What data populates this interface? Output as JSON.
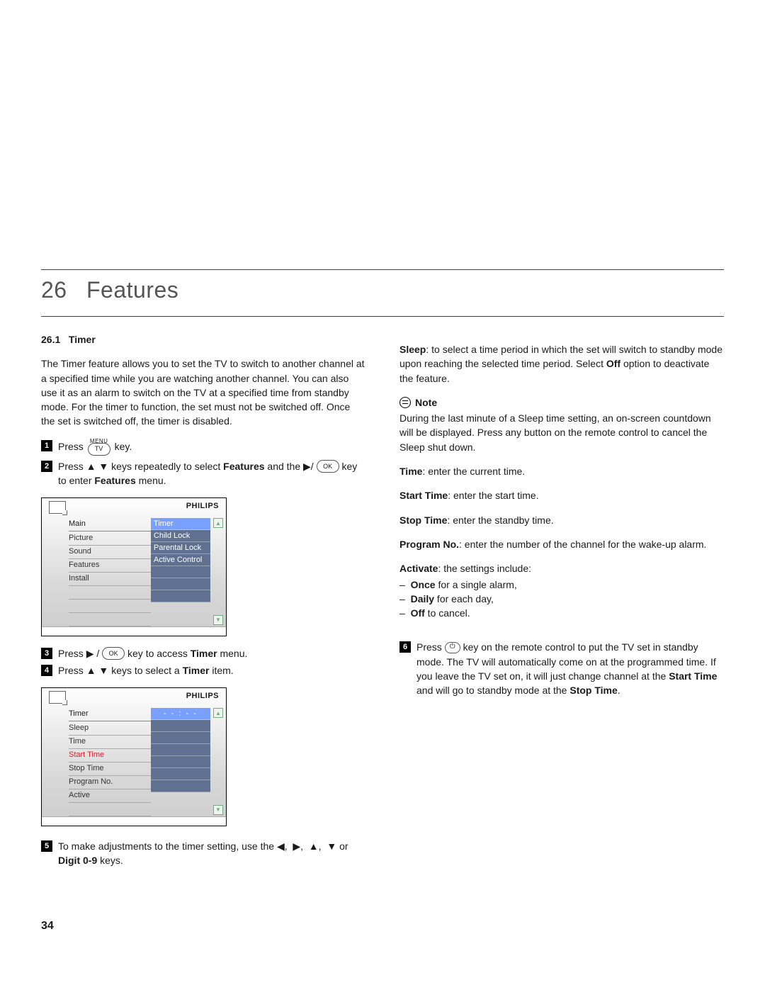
{
  "chapter": {
    "number": "26",
    "title": "Features"
  },
  "section": {
    "number": "26.1",
    "title": "Timer"
  },
  "intro_paragraph": "The Timer feature allows you to set the TV to switch to another channel at a specified time while you are watching another channel. You can also use it as an alarm to switch on the TV at a specified time from standby mode. For the timer to function, the set must not be switched off. Once the set is switched off, the timer is disabled.",
  "steps": {
    "s1_prefix": "Press ",
    "s1_suffix": " key.",
    "s1_menu_label": "MENU",
    "s1_tv_key": "TV",
    "s2_a": "Press  ",
    "s2_b": "  keys repeatedly to select ",
    "s2_c": " and the  ",
    "s2_d": " key to enter ",
    "s2_e": " menu.",
    "s2_features": "Features",
    "ok_key": "OK",
    "s3_a": "Press  ",
    "s3_b": " key to access ",
    "s3_c": " menu.",
    "s3_timer": "Timer",
    "s4_a": "Press ",
    "s4_b": " keys to select a ",
    "s4_c": " item.",
    "s4_timer": "Timer",
    "s5_a": "To make adjustments to the timer setting, use the  ",
    "s5_b": " or ",
    "s5_c": " keys.",
    "s5_digit": "Digit 0-9",
    "s6_a": "Press ",
    "s6_b": " key on the remote control to put the TV set in standby mode. The TV will automatically come on at the programmed time. If you leave the TV set on, it will just change channel at the ",
    "s6_c": " and will go to standby mode at the ",
    "s6_start": "Start Time",
    "s6_stop": "Stop Time",
    "s6_period": "."
  },
  "osd1": {
    "brand": "PHILIPS",
    "title": "Main",
    "left": [
      "Picture",
      "Sound",
      "Features",
      "Install"
    ],
    "right": [
      "Timer",
      "Child Lock",
      "Parental Lock",
      "Active Control"
    ],
    "selected_left_index": 2,
    "selected_right_index": 0
  },
  "osd2": {
    "brand": "PHILIPS",
    "title": "Timer",
    "left": [
      "Sleep",
      "Time",
      "Start Time",
      "Stop Time",
      "Program No.",
      "Active"
    ],
    "right_value": "- - : - -",
    "selected_left_index": 2,
    "highlight_right_index": 0
  },
  "right_column": {
    "sleep_label": "Sleep",
    "sleep_text": ": to select a time period in which the set will switch to standby mode upon reaching the selected time period. Select ",
    "sleep_off": "Off",
    "sleep_text2": " option to deactivate the feature.",
    "note_label": "Note",
    "note_text": "During the last minute of a Sleep time setting, an on-screen countdown will be displayed. Press any button on the remote control to cancel the Sleep shut down.",
    "time_label": "Time",
    "time_text": ": enter the current time.",
    "start_label": "Start Time",
    "start_text": ": enter the start time.",
    "stop_label": "Stop Time",
    "stop_text": ": enter the standby time.",
    "prog_label": "Program No.",
    "prog_text": ": enter the number of the channel for the wake-up alarm.",
    "activate_label": "Activate",
    "activate_text": ": the settings include:",
    "activate_opts": [
      {
        "bold": "Once",
        "rest": " for a single alarm,"
      },
      {
        "bold": "Daily",
        "rest": " for each day,"
      },
      {
        "bold": "Off",
        "rest": " to cancel."
      }
    ]
  },
  "page_number": "34"
}
